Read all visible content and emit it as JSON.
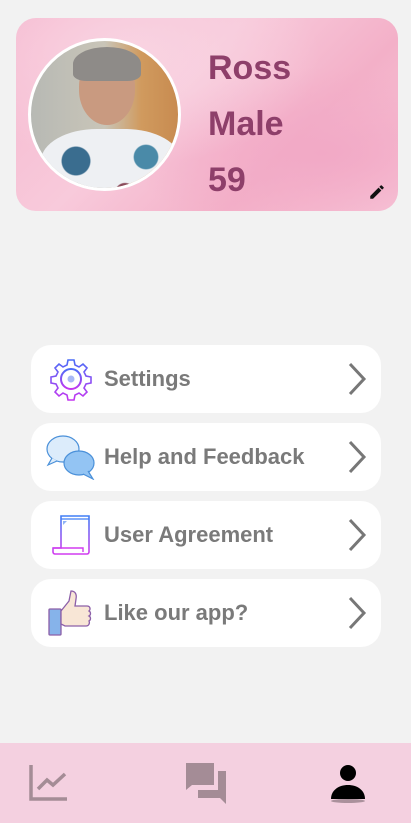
{
  "profile": {
    "name": "Ross",
    "gender": "Male",
    "age": "59"
  },
  "menu": [
    {
      "label": "Settings",
      "icon": "gear-icon"
    },
    {
      "label": "Help and Feedback",
      "icon": "chat-bubbles-icon"
    },
    {
      "label": "User Agreement",
      "icon": "document-icon"
    },
    {
      "label": "Like our app?",
      "icon": "thumbs-up-icon"
    }
  ],
  "nav": [
    {
      "icon": "chart-icon",
      "active": false
    },
    {
      "icon": "forum-icon",
      "active": false
    },
    {
      "icon": "person-icon",
      "active": true
    }
  ],
  "colors": {
    "accent": "#8e3f6a",
    "nav_bg": "#f4d0e0",
    "inactive_icon": "#a48c96"
  }
}
